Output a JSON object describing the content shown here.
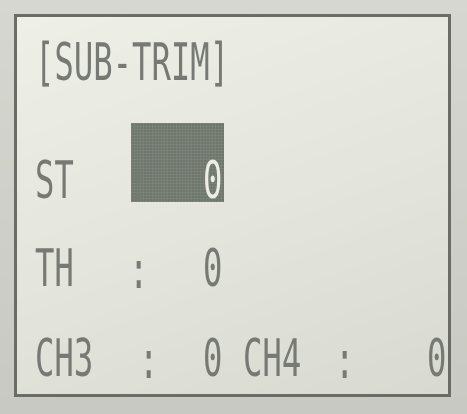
{
  "screen": {
    "title": "[SUB-TRIM]",
    "rows": {
      "st": {
        "label": "ST",
        "colon": ":",
        "value": "0",
        "selected": true
      },
      "th": {
        "label": "TH",
        "colon": ":",
        "value": "0"
      },
      "ch3": {
        "label": "CH3",
        "colon": ":",
        "value": "0"
      },
      "ch4": {
        "label": "CH4",
        "colon": ":",
        "value": "0"
      }
    }
  },
  "colors": {
    "lcd_background": "#e6e8df",
    "lcd_text": "#777a74",
    "highlight": "#6f776d",
    "highlight_text": "#eceee6",
    "border": "#6a6c66"
  }
}
